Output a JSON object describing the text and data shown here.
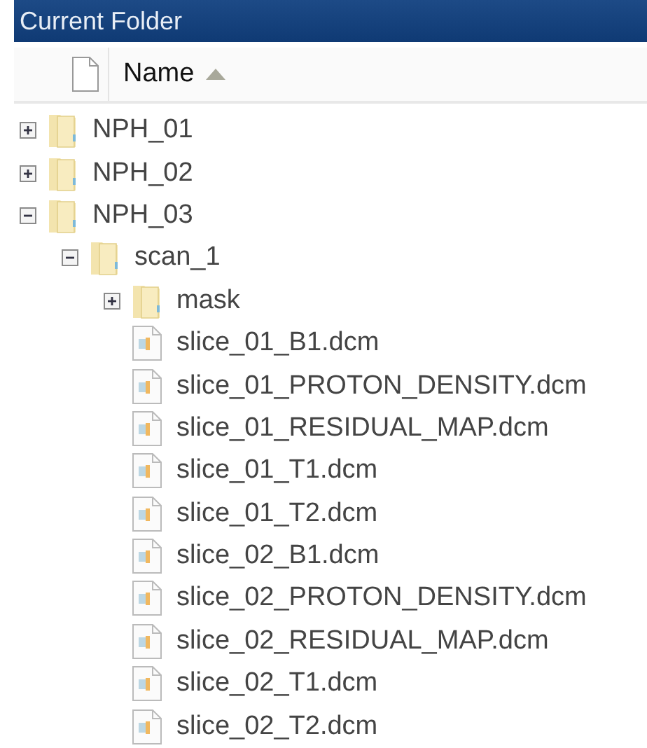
{
  "panel": {
    "title": "Current Folder"
  },
  "header": {
    "column": "Name",
    "sort_ascending": true
  },
  "tree": [
    {
      "kind": "folder",
      "name": "NPH_01",
      "expanded": false
    },
    {
      "kind": "folder",
      "name": "NPH_02",
      "expanded": false
    },
    {
      "kind": "folder",
      "name": "NPH_03",
      "expanded": true,
      "children": [
        {
          "kind": "folder",
          "name": "scan_1",
          "expanded": true,
          "children": [
            {
              "kind": "folder",
              "name": "mask",
              "expanded": false
            },
            {
              "kind": "file",
              "name": "slice_01_B1.dcm"
            },
            {
              "kind": "file",
              "name": "slice_01_PROTON_DENSITY.dcm"
            },
            {
              "kind": "file",
              "name": "slice_01_RESIDUAL_MAP.dcm"
            },
            {
              "kind": "file",
              "name": "slice_01_T1.dcm"
            },
            {
              "kind": "file",
              "name": "slice_01_T2.dcm"
            },
            {
              "kind": "file",
              "name": "slice_02_B1.dcm"
            },
            {
              "kind": "file",
              "name": "slice_02_PROTON_DENSITY.dcm"
            },
            {
              "kind": "file",
              "name": "slice_02_RESIDUAL_MAP.dcm"
            },
            {
              "kind": "file",
              "name": "slice_02_T1.dcm"
            },
            {
              "kind": "file",
              "name": "slice_02_T2.dcm"
            }
          ]
        }
      ]
    }
  ]
}
